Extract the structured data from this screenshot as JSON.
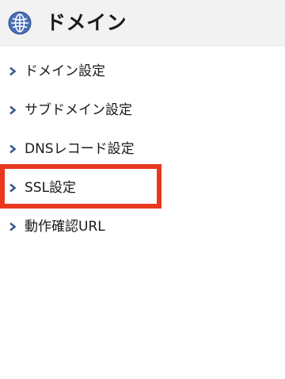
{
  "header": {
    "icon": "globe-icon",
    "title": "ドメイン"
  },
  "menu": {
    "items": [
      {
        "label": "ドメイン設定",
        "icon": "chevron-right-icon"
      },
      {
        "label": "サブドメイン設定",
        "icon": "chevron-right-icon"
      },
      {
        "label": "DNSレコード設定",
        "icon": "chevron-right-icon"
      },
      {
        "label": "SSL設定",
        "icon": "chevron-right-icon",
        "highlighted": true
      },
      {
        "label": "動作確認URL",
        "icon": "chevron-right-icon"
      }
    ]
  },
  "colors": {
    "header_bg": "#f2f2f2",
    "globe_blue": "#4a6fb5",
    "chevron_blue": "#3d5a8c",
    "highlight_red": "#e8381f",
    "text": "#1a1a1a"
  }
}
